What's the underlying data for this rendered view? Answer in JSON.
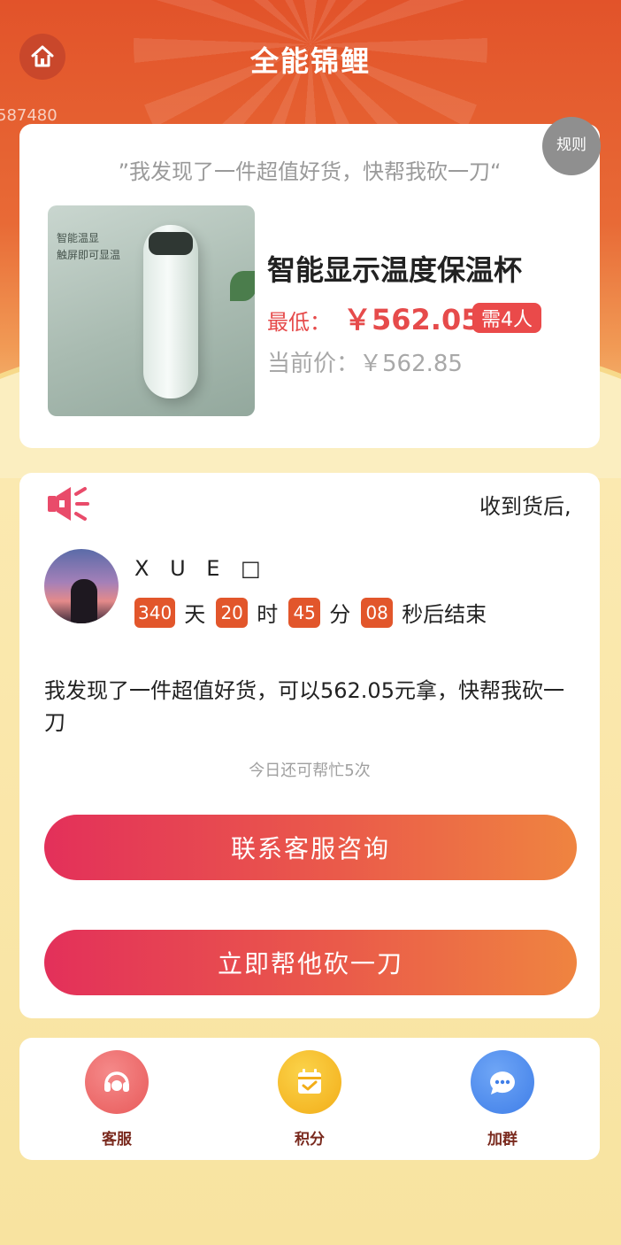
{
  "header": {
    "title": "全能锦鲤",
    "side_number": "587480"
  },
  "product": {
    "rule_label": "规则",
    "quote": "”我发现了一件超值好货，快帮我砍一刀“",
    "image_text_line1": "智能温显",
    "image_text_line2": "触屏即可显温",
    "name": "智能显示温度保温杯",
    "lowest_label": "最低：",
    "lowest_price": "￥562.05",
    "need_badge": "需4人",
    "current_price_text": "当前价：￥562.85"
  },
  "main": {
    "notice": "收到货后,",
    "user_name": "X U E □",
    "countdown": {
      "days": "340",
      "days_unit": "天",
      "hours": "20",
      "hours_unit": "时",
      "minutes": "45",
      "minutes_unit": "分",
      "seconds": "08",
      "seconds_unit": "秒后结束"
    },
    "share_text": "我发现了一件超值好货，可以562.05元拿，快帮我砍一刀",
    "remaining_times": "今日还可帮忙5次",
    "contact_button": "联系客服咨询",
    "cut_button": "立即帮他砍一刀"
  },
  "bottom_nav": [
    {
      "label": "客服",
      "icon": "headset-icon",
      "color": "#f06a6a"
    },
    {
      "label": "积分",
      "icon": "calendar-check-icon",
      "color": "#f5b922"
    },
    {
      "label": "加群",
      "icon": "chat-bubble-icon",
      "color": "#4a8df2"
    }
  ]
}
